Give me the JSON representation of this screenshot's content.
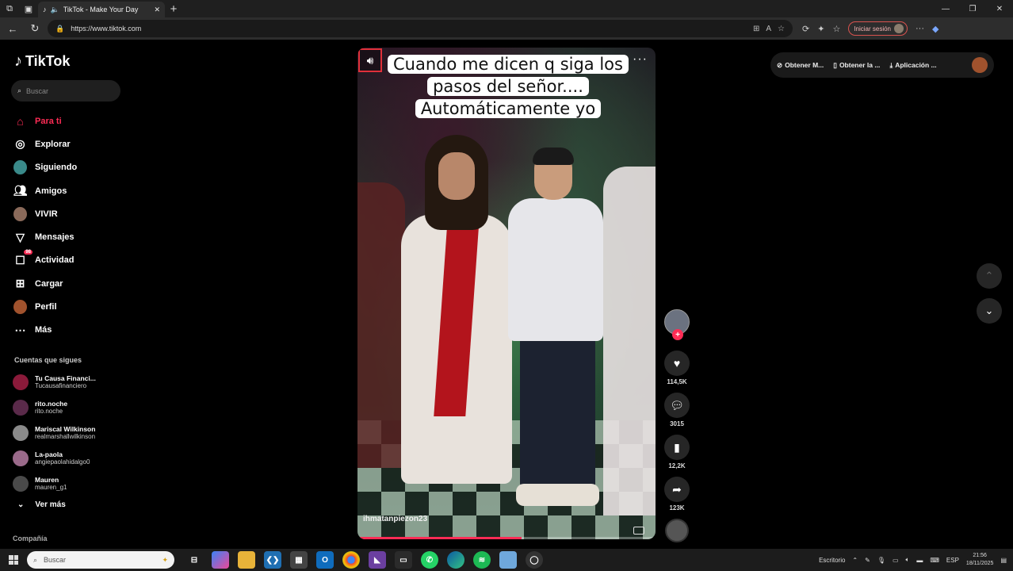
{
  "browser": {
    "tab_title": "TikTok - Make Your Day",
    "url": "https://www.tiktok.com",
    "signin_label": "Iniciar sesión"
  },
  "sidebar": {
    "logo_text": "TikTok",
    "search_placeholder": "Buscar",
    "menu": [
      {
        "label": "Para ti",
        "icon": "home-icon"
      },
      {
        "label": "Explorar",
        "icon": "compass-icon"
      },
      {
        "label": "Siguiendo",
        "icon": "following-avatar"
      },
      {
        "label": "Amigos",
        "icon": "friends-icon"
      },
      {
        "label": "VIVIR",
        "icon": "live-avatar"
      },
      {
        "label": "Mensajes",
        "icon": "send-icon"
      },
      {
        "label": "Actividad",
        "icon": "activity-icon",
        "badge": "98"
      },
      {
        "label": "Cargar",
        "icon": "upload-icon"
      },
      {
        "label": "Perfil",
        "icon": "profile-avatar"
      },
      {
        "label": "Más",
        "icon": "more-icon"
      }
    ],
    "following_title": "Cuentas que sigues",
    "following": [
      {
        "name": "Tu Causa Financi...",
        "user": "Tucausafinanciero",
        "color": "#8b1a3a"
      },
      {
        "name": "rito.noche",
        "user": "rito.noche",
        "color": "#5a2a4a"
      },
      {
        "name": "Mariscal Wilkinson",
        "user": "realmarshallwilkinson",
        "color": "#8a8a8a"
      },
      {
        "name": "La-paola",
        "user": "angiepaolahidalgo0",
        "color": "#9a6a8a"
      },
      {
        "name": "Mauren",
        "user": "mauren_g1",
        "color": "#4a4a4a"
      }
    ],
    "see_more": "Ver más",
    "company": "Compañía"
  },
  "video": {
    "caption": "Cuando me dicen q siga los pasos del señor.... Automáticamente yo",
    "watermark": "ihmatanpiezon23",
    "progress": 0.55
  },
  "actions": {
    "likes": "114,5K",
    "comments": "3015",
    "saves": "12,2K",
    "shares": "123K"
  },
  "top_right": {
    "item1": "Obtener M...",
    "item2": "Obtener la ...",
    "item3": "Aplicación ..."
  },
  "taskbar": {
    "search_placeholder": "Buscar",
    "desktop_label": "Escritorio",
    "lang": "ESP",
    "time": "21:56",
    "date": "18/11/2025"
  },
  "colors": {
    "accent": "#fe2c55"
  }
}
